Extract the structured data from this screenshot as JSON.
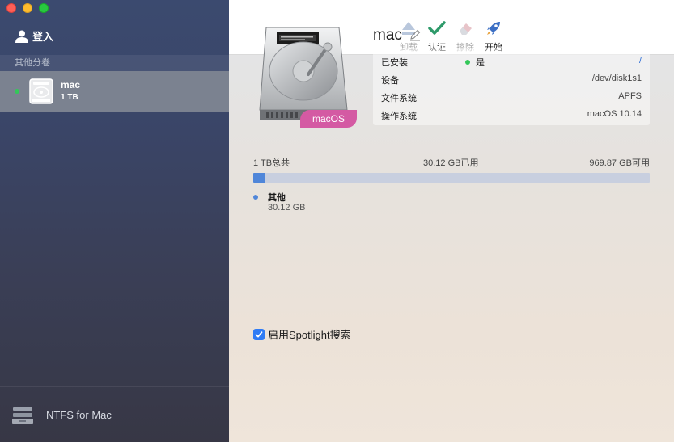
{
  "sidebar": {
    "login_label": "登入",
    "section_title": "其他分卷",
    "volumes": [
      {
        "name": "mac",
        "size": "1 TB",
        "status_color": "#34c759"
      }
    ],
    "footer_brand": "NTFS for Mac"
  },
  "toolbar": {
    "unmount_label": "卸载",
    "verify_label": "认证",
    "erase_label": "擦除",
    "startup_label": "开始"
  },
  "volume": {
    "title": "mac",
    "os_badge": "macOS",
    "info": {
      "mounted_label": "已安装",
      "mounted_value": "是",
      "mount_path": "/",
      "device_label": "设备",
      "device_value": "/dev/disk1s1",
      "filesystem_label": "文件系统",
      "filesystem_value": "APFS",
      "os_label": "操作系统",
      "os_value": "macOS 10.14"
    },
    "usage": {
      "total_label": "1 TB总共",
      "used_label": "30.12 GB已用",
      "free_label": "969.87 GB可用",
      "used_fraction": 0.03,
      "legend_name": "其他",
      "legend_value": "30.12 GB"
    },
    "spotlight_label": "启用Spotlight搜索",
    "spotlight_checked": true
  },
  "colors": {
    "accent_blue": "#4f86d9",
    "badge_pink": "#d45aa3",
    "status_green": "#34c759"
  }
}
